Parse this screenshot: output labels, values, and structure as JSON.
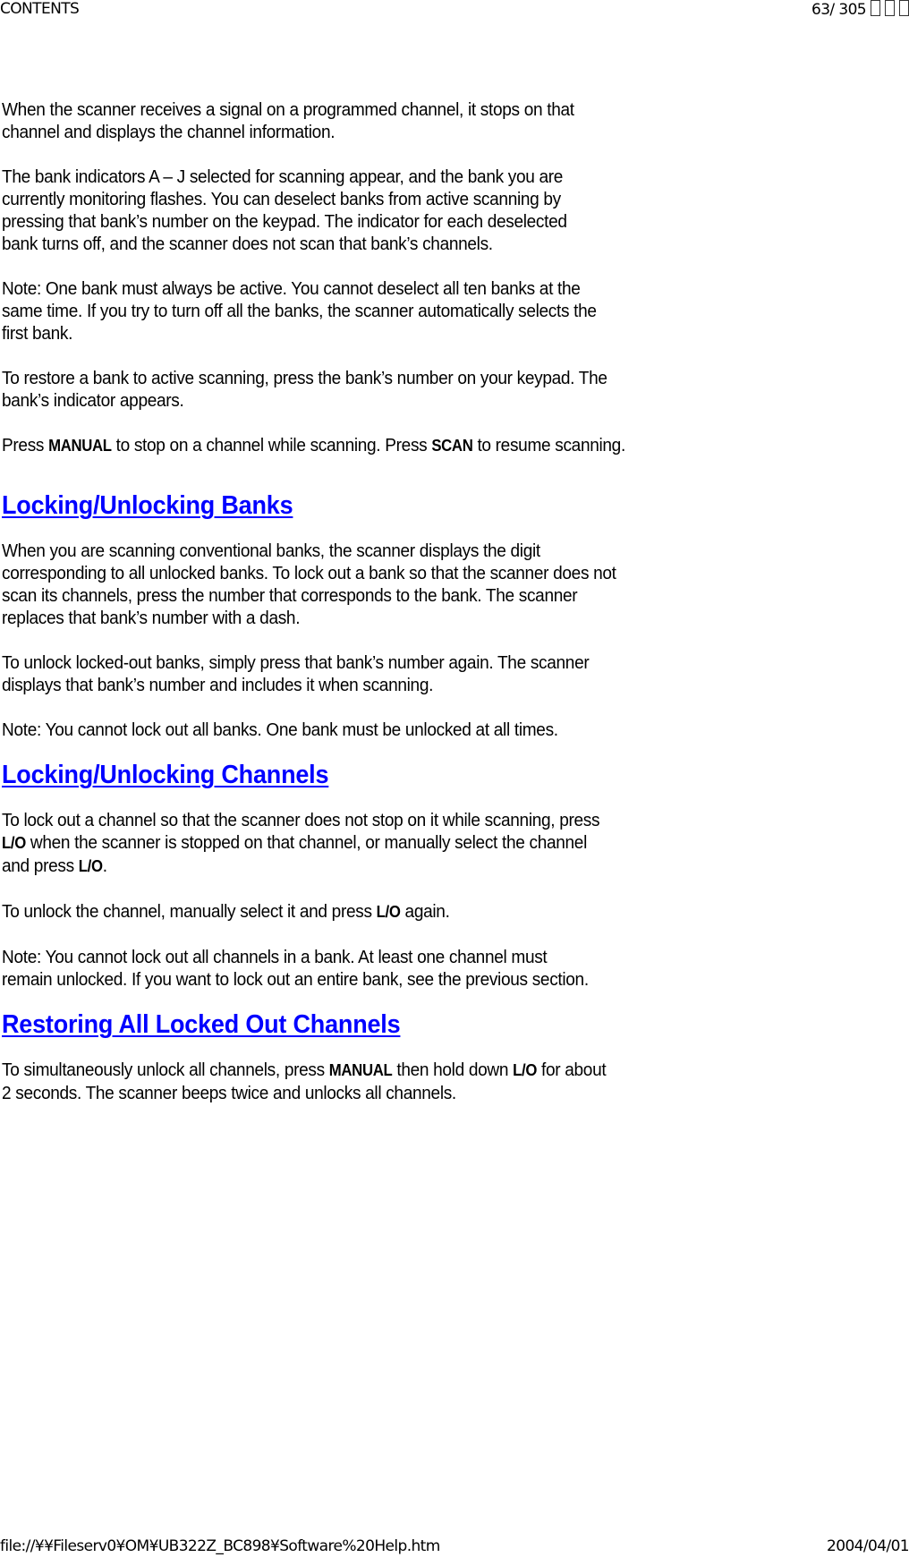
{
  "header": {
    "left": "CONTENTS",
    "page_number": "63/ 305",
    "trailing_glyphs": [
      "box",
      "box",
      "box"
    ]
  },
  "footer": {
    "path": "file://¥¥Fileserv0¥OM¥UB322Z_BC898¥Software%20Help.htm",
    "date": "2004/04/01"
  },
  "intro": {
    "p1": "When the scanner receives a signal on a programmed channel, it stops on that channel and displays the channel information.",
    "p2": "The bank indicators A – J selected for scanning appear, and the bank you are currently monitoring flashes. You can deselect banks from active scanning by pressing that bank’s number on the keypad. The indicator for each deselected bank turns off, and the scanner does not scan that bank’s channels.",
    "p3": "Note: One bank must always be active. You cannot deselect all ten banks at the same time. If you try to turn off all the banks, the scanner automatically selects the first bank.",
    "p4": "To restore a bank to active scanning, press the bank’s number on your keypad. The bank’s indicator appears.",
    "p5": {
      "t1": "Press ",
      "k1": "MANUAL",
      "t2": " to stop on a channel while scanning. Press ",
      "k2": "SCAN",
      "t3": " to resume scanning."
    }
  },
  "sections": [
    {
      "heading": "Locking/Unlocking Banks",
      "p1": "When you are scanning conventional banks, the scanner displays the digit corresponding to all unlocked banks. To lock out a bank so that the scanner does not scan its channels, press the number that corresponds to the bank. The scanner replaces that bank’s number with a dash.",
      "p2": "To unlock locked-out banks, simply press that bank’s number again. The scanner displays that bank’s number and includes it when scanning.",
      "p3": "Note: You cannot lock out all banks. One bank must be unlocked at all times."
    },
    {
      "heading": "Locking/Unlocking Channels",
      "p1": {
        "line1": "To lock out a channel so that the scanner does not stop on it while scanning, press",
        "k1": "L/O",
        "line2": " when the scanner is stopped on that channel, or manually select the channel",
        "line3": "and press ",
        "k2": "L/O",
        "end": "."
      },
      "p2": {
        "t1": "To unlock the channel, manually select it and press ",
        "k1": "L/O",
        "t2": " again."
      },
      "p3": "Note: You cannot lock out all channels in a bank. At least one channel must remain unlocked. If you want to lock out an entire bank, see the previous section."
    },
    {
      "heading": "Restoring All Locked Out Channels",
      "p1": {
        "t1": "To simultaneously unlock all channels, press ",
        "k1": "MANUAL",
        "t2": " then hold down ",
        "k2": "L/O",
        "t3": " for about 2 seconds. The scanner beeps twice and unlocks all channels."
      }
    }
  ],
  "colors": {
    "heading": "#0000ff",
    "text": "#000000",
    "background": "#ffffff"
  }
}
